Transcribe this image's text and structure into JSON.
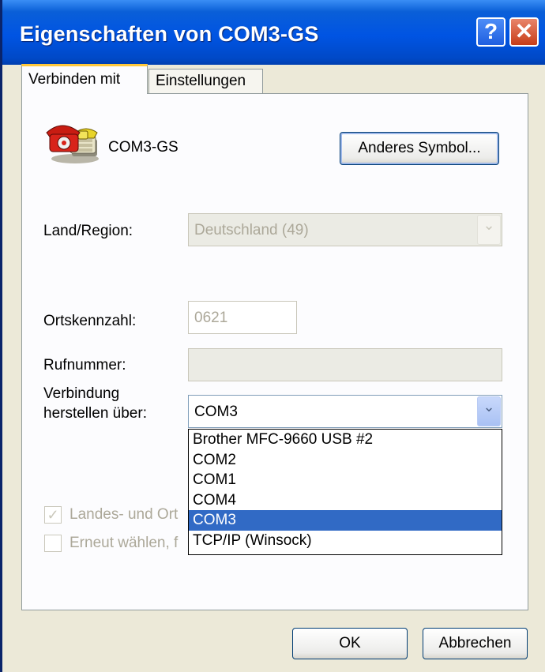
{
  "window": {
    "title": "Eigenschaften von COM3-GS",
    "help_glyph": "?",
    "close_glyph": "✕"
  },
  "tabs": [
    {
      "label": "Verbinden mit",
      "active": true
    },
    {
      "label": "Einstellungen",
      "active": false
    }
  ],
  "connection": {
    "name": "COM3-GS",
    "icon": "phone-icon",
    "change_icon_label": "Anderes Symbol..."
  },
  "form": {
    "region_label": "Land/Region:",
    "region_value": "Deutschland (49)",
    "area_code_label": "Ortskennzahl:",
    "area_code_value": "0621",
    "phone_label": "Rufnummer:",
    "phone_value": "",
    "connect_via_label_1": "Verbindung",
    "connect_via_label_2": "herstellen über:",
    "connect_via_value": "COM3",
    "connect_via_options": [
      "Brother MFC-9660 USB #2",
      "COM2",
      "COM1",
      "COM4",
      "COM3",
      "TCP/IP (Winsock)"
    ],
    "connect_via_selected": "COM3",
    "checkbox_country_label": "Landes- und Ort",
    "checkbox_country_checked": true,
    "checkbox_redial_label": "Erneut wählen, f",
    "checkbox_redial_checked": false
  },
  "footer": {
    "ok_label": "OK",
    "cancel_label": "Abbrechen"
  },
  "colors": {
    "titlebar": "#0054e3",
    "selection": "#316ac5",
    "tab_highlight": "#ffc83c",
    "face": "#ece9d8"
  }
}
